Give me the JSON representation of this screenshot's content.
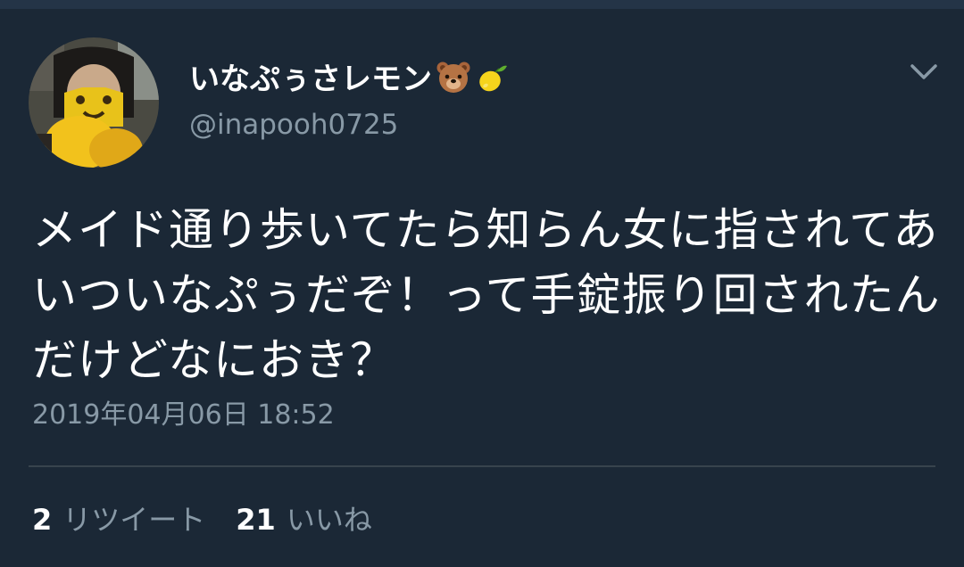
{
  "user": {
    "display_name": "いなぷぅさレモン",
    "handle": "@inapooh0725",
    "name_emojis": [
      "bear-face-icon",
      "lemon-icon"
    ]
  },
  "tweet": {
    "text": "メイド通り歩いてたら知らん女に指されてあいついなぷぅだぞ！って手錠振り回されたんだけどなにおき？",
    "timestamp": "2019年04月06日 18:52"
  },
  "stats": {
    "retweets_count": "2",
    "retweets_label": "リツイート",
    "likes_count": "21",
    "likes_label": "いいね"
  },
  "colors": {
    "background": "#1b2836",
    "secondary_text": "#8899a6",
    "divider": "#38444d"
  }
}
